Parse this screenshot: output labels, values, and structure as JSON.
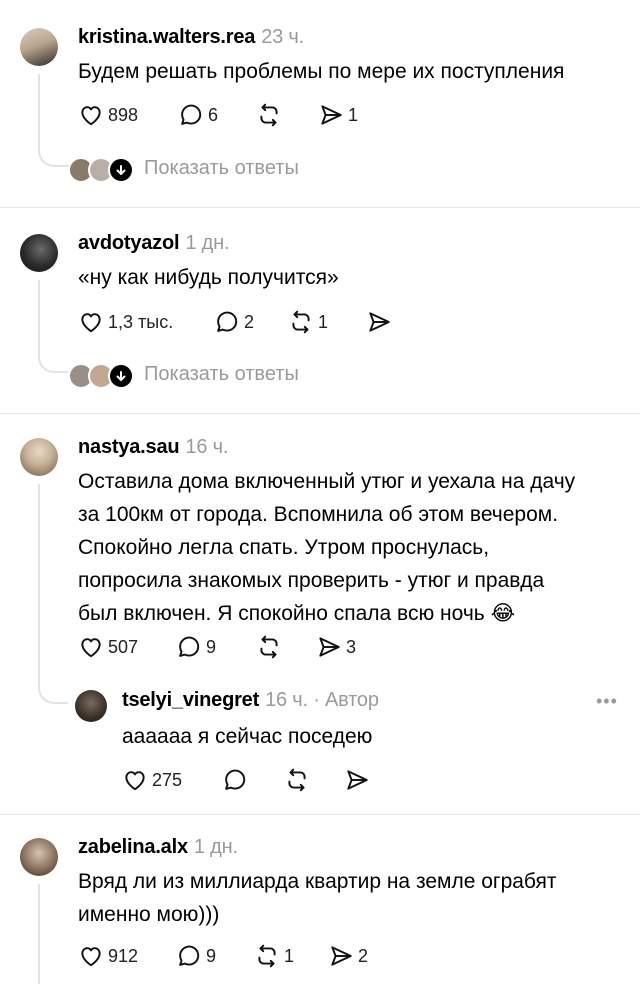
{
  "show_replies_label": "Показать ответы",
  "posts": [
    {
      "username": "kristina.walters.rea",
      "time": "23 ч.",
      "lines": [
        "Будем решать проблемы по мере их поступления"
      ],
      "likes": "898",
      "replies": "6",
      "reposts": "",
      "shares": "1"
    },
    {
      "username": "avdotyazol",
      "time": "1 дн.",
      "lines": [
        "«ну как нибудь получится»"
      ],
      "likes": "1,3 тыс.",
      "replies": "2",
      "reposts": "1",
      "shares": ""
    },
    {
      "username": "nastya.sau",
      "time": "16 ч.",
      "lines": [
        "Оставила дома включенный утюг и уехала на дачу",
        "за 100км от города. Вспомнила об этом вечером.",
        "Спокойно легла спать. Утром проснулась,",
        "попросила знакомых проверить - утюг и правда",
        "был включен. Я спокойно спала всю ночь 😂"
      ],
      "likes": "507",
      "replies": "9",
      "reposts": "",
      "shares": "3",
      "reply": {
        "username": "tselyi_vinegret",
        "time": "16 ч. · Автор",
        "text": "аааааа я сейчас поседею",
        "likes": "275",
        "replies": "",
        "reposts": "",
        "shares": "",
        "more": "•••"
      }
    },
    {
      "username": "zabelina.alx",
      "time": "1 дн.",
      "lines": [
        "Вряд ли из миллиарда квартир на земле ограбят",
        "именно мою)))"
      ],
      "likes": "912",
      "replies": "9",
      "reposts": "1",
      "shares": "2"
    }
  ]
}
